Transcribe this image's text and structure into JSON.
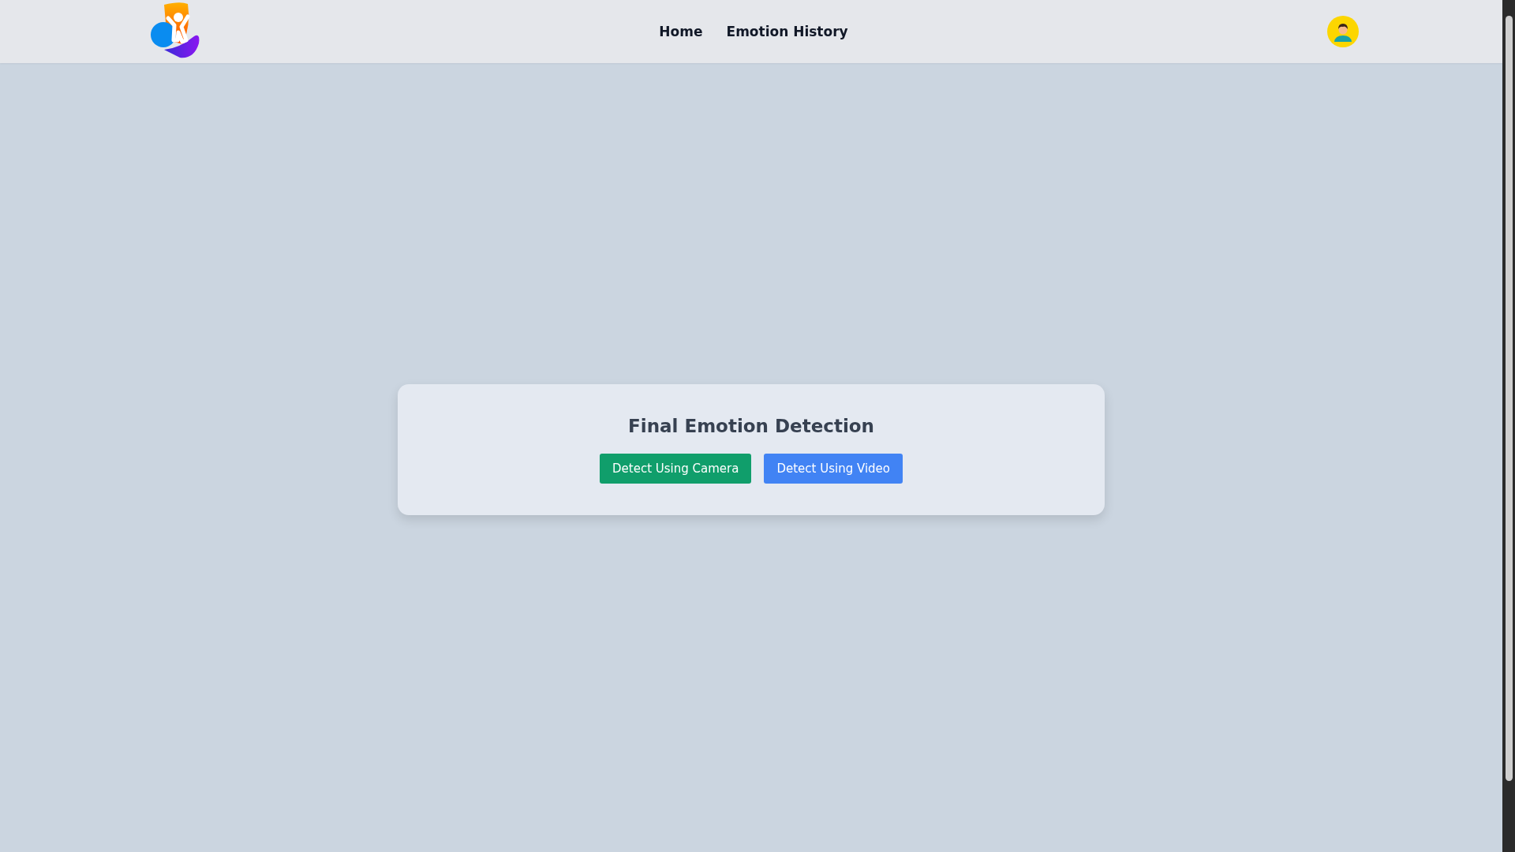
{
  "nav": {
    "links": [
      {
        "label": "Home"
      },
      {
        "label": "Emotion History"
      }
    ]
  },
  "card": {
    "title": "Final Emotion Detection",
    "buttons": [
      {
        "label": "Detect Using Camera",
        "color": "#109e6b"
      },
      {
        "label": "Detect Using Video",
        "color": "#4183f4"
      }
    ]
  }
}
